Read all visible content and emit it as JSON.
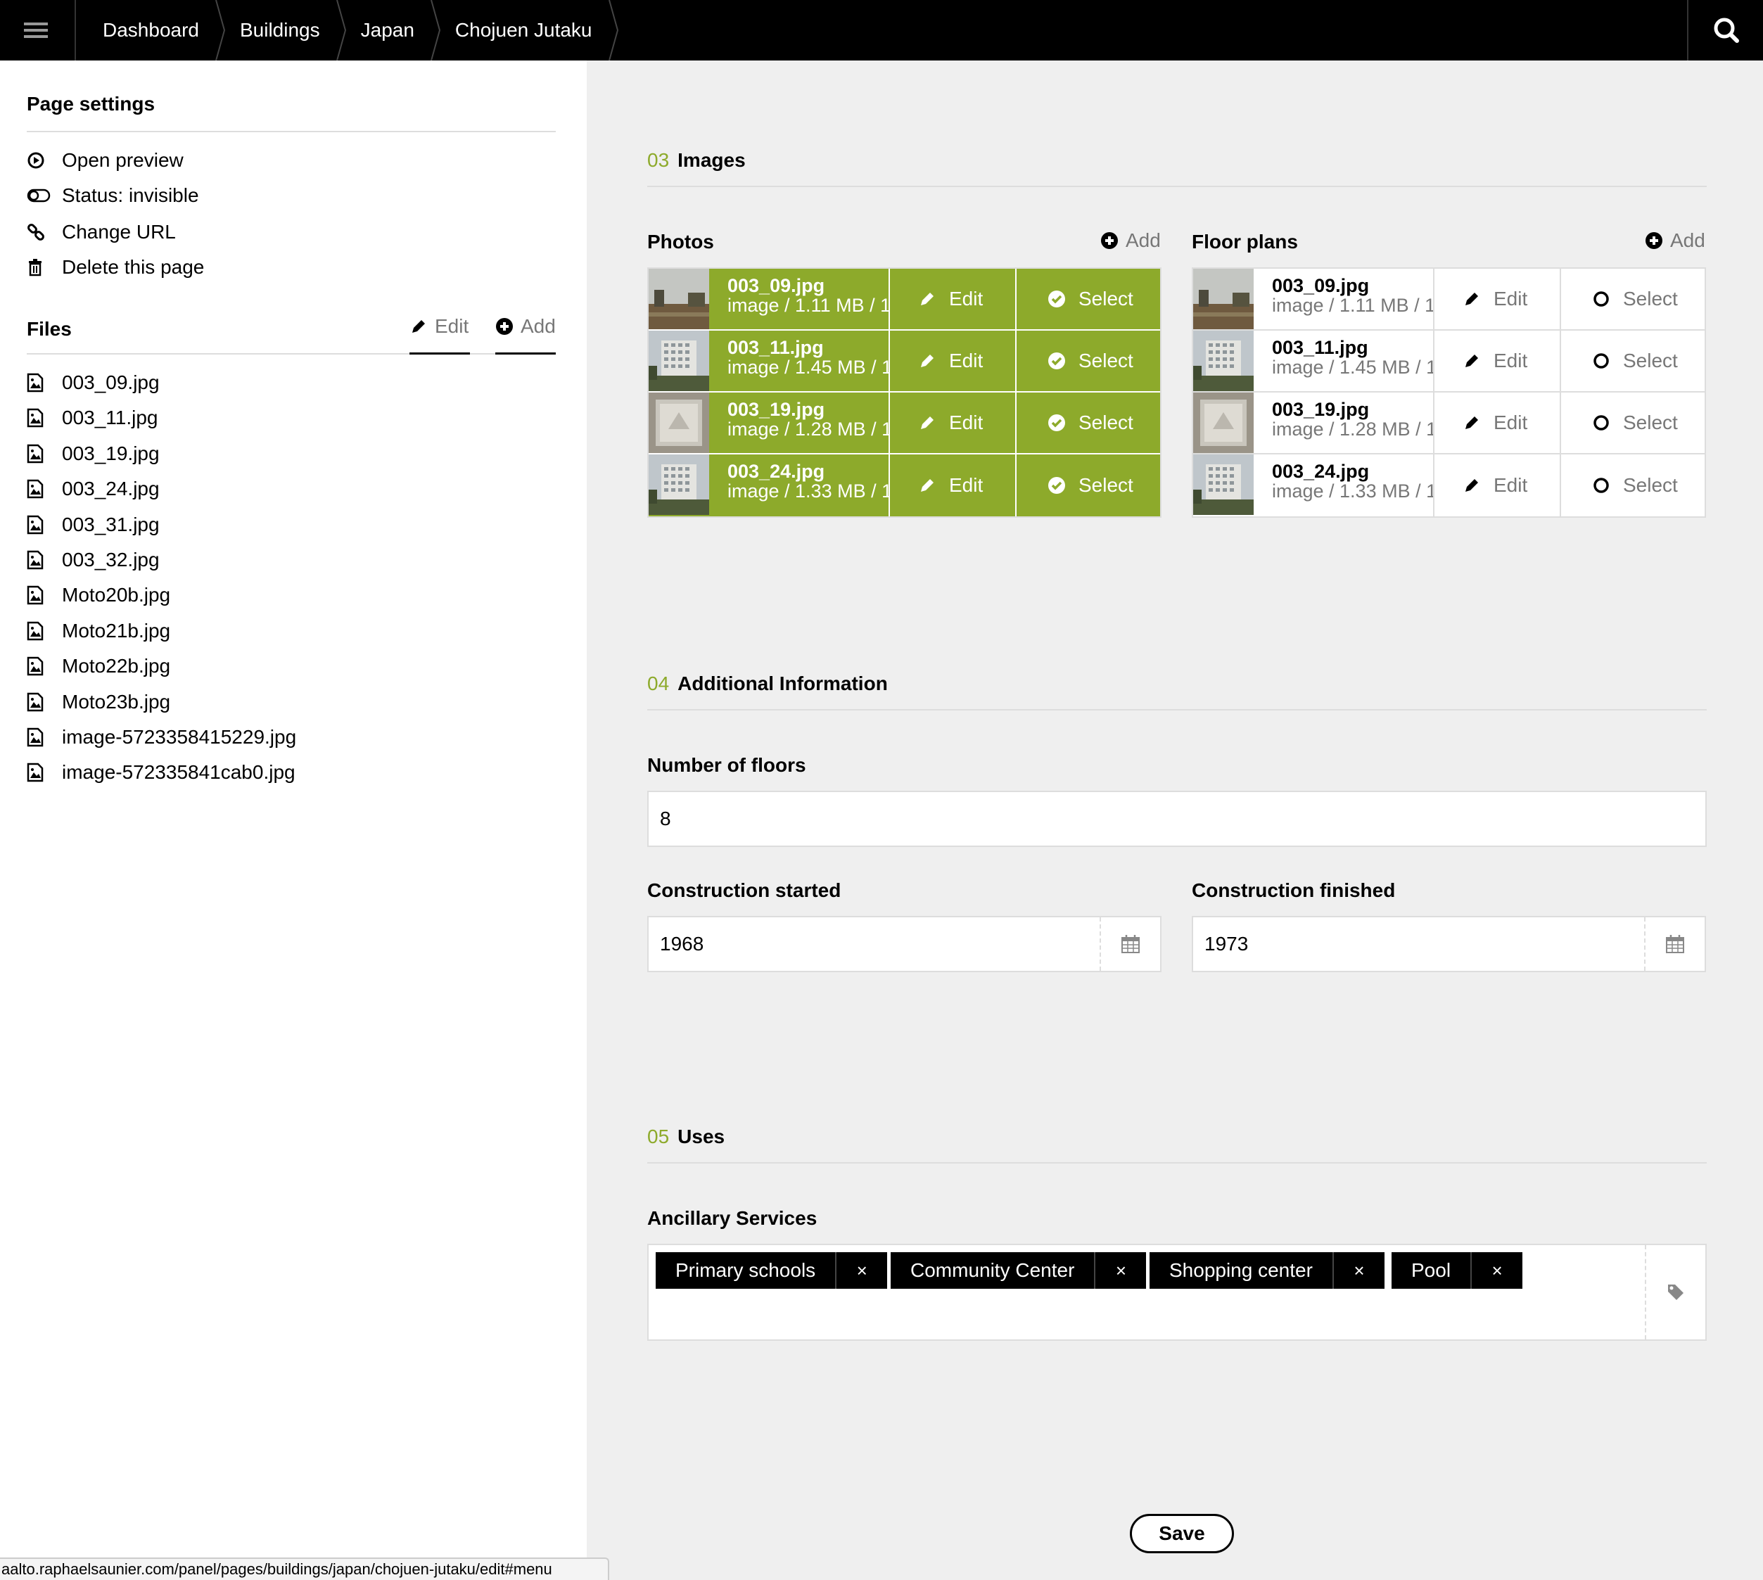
{
  "topbar": {
    "breadcrumb": [
      "Dashboard",
      "Buildings",
      "Japan",
      "Chojuen Jutaku"
    ]
  },
  "sidebar": {
    "page_settings_title": "Page settings",
    "actions": [
      {
        "label": "Open preview",
        "icon": "play-circle-icon"
      },
      {
        "label": "Status: invisible",
        "icon": "toggle-icon"
      },
      {
        "label": "Change URL",
        "icon": "link-icon"
      },
      {
        "label": "Delete this page",
        "icon": "trash-icon"
      }
    ],
    "files_title": "Files",
    "files_edit": "Edit",
    "files_add": "Add",
    "files": [
      "003_09.jpg",
      "003_11.jpg",
      "003_19.jpg",
      "003_24.jpg",
      "003_31.jpg",
      "003_32.jpg",
      "Moto20b.jpg",
      "Moto21b.jpg",
      "Moto22b.jpg",
      "Moto23b.jpg",
      "image-5723358415229.jpg",
      "image-572335841cab0.jpg"
    ]
  },
  "images": {
    "num": "03",
    "title": "Images",
    "photos_label": "Photos",
    "floor_label": "Floor plans",
    "add": "Add",
    "edit": "Edit",
    "select": "Select",
    "items": [
      {
        "name": "003_09.jpg",
        "meta": "image / 1.11 MB / 1"
      },
      {
        "name": "003_11.jpg",
        "meta": "image / 1.45 MB / 1"
      },
      {
        "name": "003_19.jpg",
        "meta": "image / 1.28 MB / 1"
      },
      {
        "name": "003_24.jpg",
        "meta": "image / 1.33 MB / 1"
      }
    ]
  },
  "additional": {
    "num": "04",
    "title": "Additional Information",
    "floors_label": "Number of floors",
    "floors_value": "8",
    "started_label": "Construction started",
    "started_value": "1968",
    "finished_label": "Construction finished",
    "finished_value": "1973"
  },
  "uses": {
    "num": "05",
    "title": "Uses",
    "ancillary_label": "Ancillary Services",
    "tags": [
      "Primary schools",
      "Community Center",
      "Shopping center",
      "Pool"
    ],
    "remove": "×"
  },
  "save_label": "Save",
  "status_url": "aalto.raphaelsaunier.com/panel/pages/buildings/japan/chojuen-jutaku/edit#menu",
  "colors": {
    "accent": "#8daa2b",
    "topbar": "#000000"
  }
}
